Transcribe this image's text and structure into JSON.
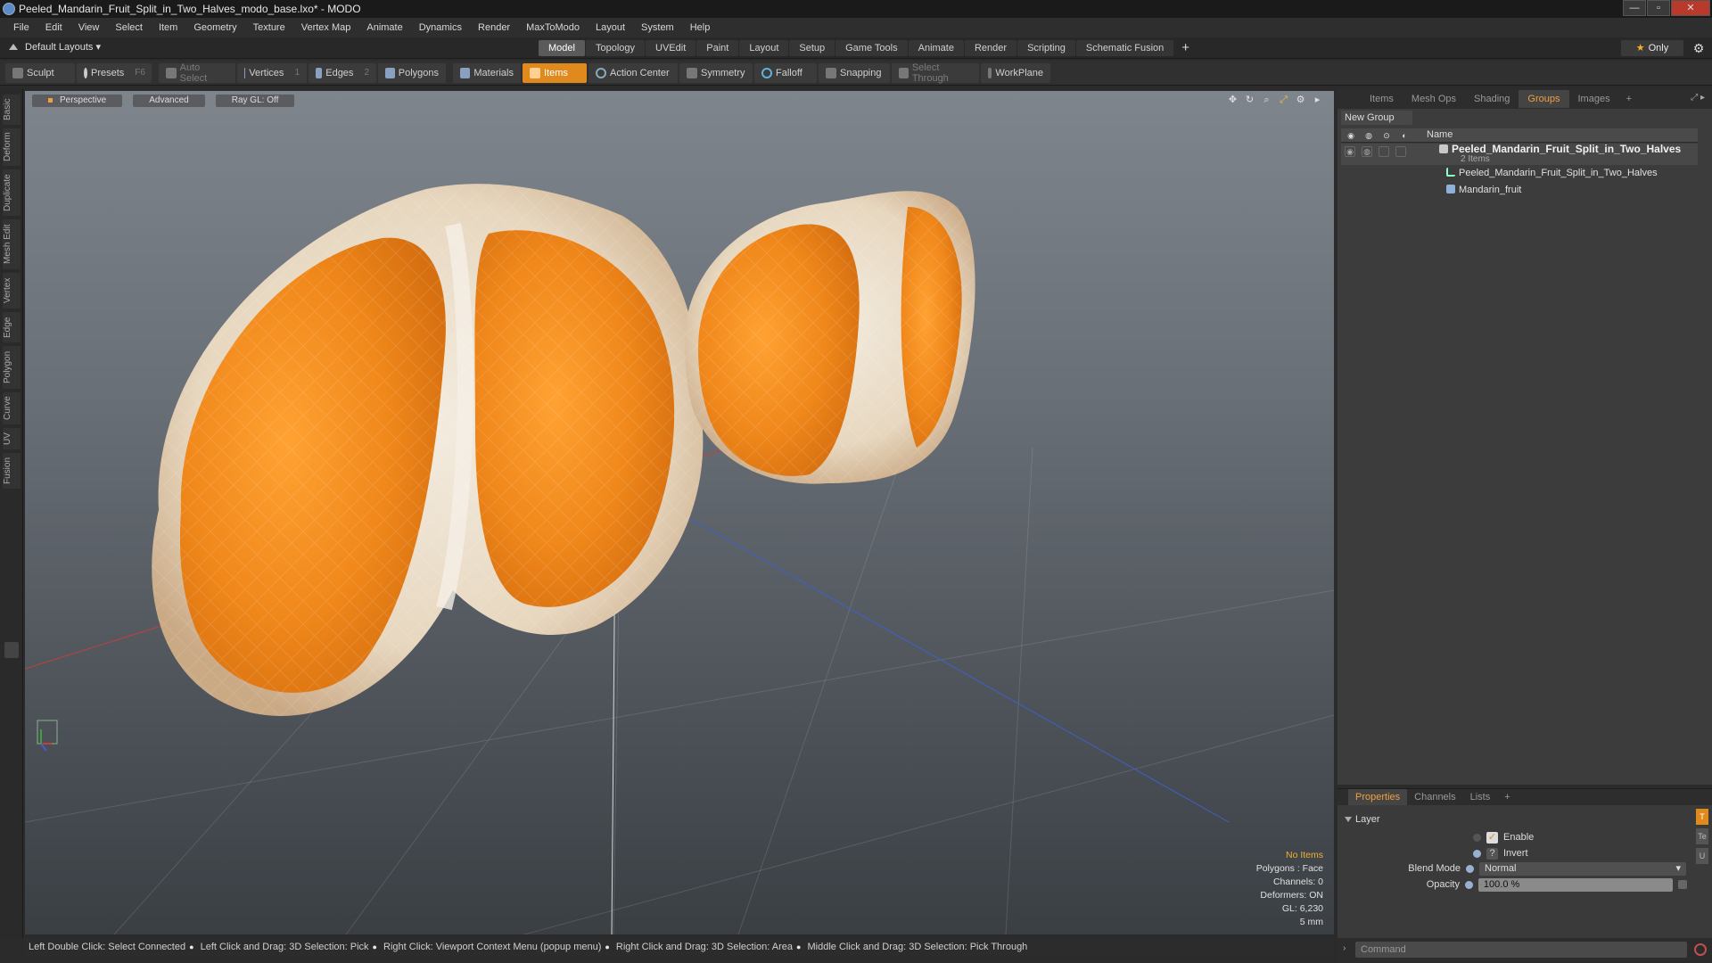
{
  "window": {
    "title": "Peeled_Mandarin_Fruit_Split_in_Two_Halves_modo_base.lxo* - MODO",
    "minimize": "—",
    "maximize": "▫",
    "close": "✕"
  },
  "menu": [
    "File",
    "Edit",
    "View",
    "Select",
    "Item",
    "Geometry",
    "Texture",
    "Vertex Map",
    "Animate",
    "Dynamics",
    "Render",
    "MaxToModo",
    "Layout",
    "System",
    "Help"
  ],
  "layout": {
    "preset": "Default Layouts ▾",
    "tabs": [
      "Model",
      "Topology",
      "UVEdit",
      "Paint",
      "Layout",
      "Setup",
      "Game Tools",
      "Animate",
      "Render",
      "Scripting",
      "Schematic Fusion"
    ],
    "active_tab": "Model",
    "add": "+",
    "only_label": "Only"
  },
  "toolbar": {
    "sculpt": "Sculpt",
    "presets": "Presets",
    "presets_key": "F6",
    "auto_select": "Auto Select",
    "vertices": "Vertices",
    "vertices_num": "1",
    "edges": "Edges",
    "edges_num": "2",
    "polygons": "Polygons",
    "materials": "Materials",
    "items": "Items",
    "action_center": "Action Center",
    "symmetry": "Symmetry",
    "falloff": "Falloff",
    "snapping": "Snapping",
    "select_through": "Select Through",
    "workplane": "WorkPlane"
  },
  "left_tabs": [
    "Basic",
    "Deform",
    "Duplicate",
    "Mesh Edit",
    "Vertex",
    "Edge",
    "Polygon",
    "Curve",
    "UV",
    "Fusion"
  ],
  "viewport": {
    "view": "Perspective",
    "shading": "Advanced",
    "raygl": "Ray GL: Off",
    "info": {
      "items": "No Items",
      "polygons": "Polygons : Face",
      "channels": "Channels: 0",
      "deformers": "Deformers: ON",
      "gl": "GL: 6,230",
      "scale": "5 mm"
    }
  },
  "status": [
    "Left Double Click: Select Connected",
    "Left Click and Drag: 3D Selection: Pick",
    "Right Click: Viewport Context Menu (popup menu)",
    "Right Click and Drag: 3D Selection: Area",
    "Middle Click and Drag: 3D Selection: Pick Through"
  ],
  "right_panel": {
    "tabs": [
      "Items",
      "Mesh Ops",
      "Shading",
      "Groups",
      "Images"
    ],
    "active_tab": "Groups",
    "new_group": "New Group",
    "col_name": "Name",
    "group": {
      "name": "Peeled_Mandarin_Fruit_Split_in_Two_Halves",
      "count": "2 Items",
      "children": [
        "Peeled_Mandarin_Fruit_Split_in_Two_Halves",
        "Mandarin_fruit"
      ]
    }
  },
  "properties": {
    "tabs": [
      "Properties",
      "Channels",
      "Lists"
    ],
    "active_tab": "Properties",
    "section": "Layer",
    "enable": "Enable",
    "invert": "Invert",
    "blend_label": "Blend Mode",
    "blend_value": "Normal",
    "opacity_label": "Opacity",
    "opacity_value": "100.0 %"
  },
  "command": {
    "placeholder": "Command"
  },
  "colors": {
    "accent": "#e08a1e",
    "fruit": "#f08a1c",
    "pith": "#efe4d4"
  }
}
